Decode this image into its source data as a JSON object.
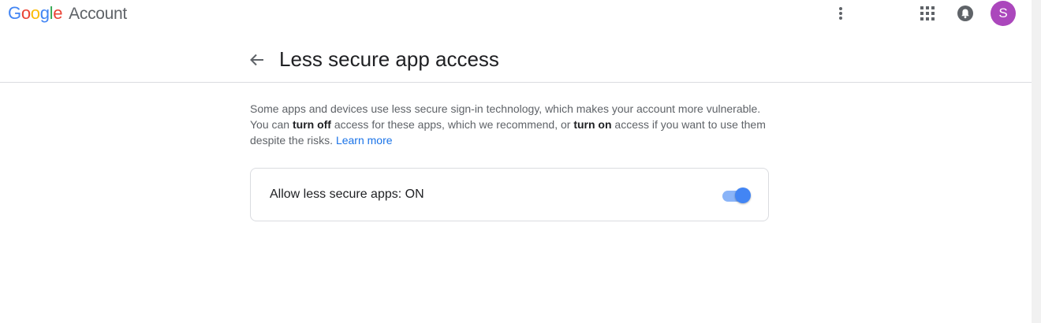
{
  "header": {
    "logo_letters": [
      {
        "char": "G",
        "color": "#4285F4"
      },
      {
        "char": "o",
        "color": "#EA4335"
      },
      {
        "char": "o",
        "color": "#FBBC05"
      },
      {
        "char": "g",
        "color": "#4285F4"
      },
      {
        "char": "l",
        "color": "#34A853"
      },
      {
        "char": "e",
        "color": "#EA4335"
      }
    ],
    "product_label": "Account",
    "icons": {
      "more": "more-vert-icon",
      "apps": "apps-grid-icon",
      "notifications": "bell-icon"
    },
    "avatar_initial": "S",
    "avatar_color": "#AB47BC"
  },
  "page": {
    "title": "Less secure app access",
    "back_icon": "arrow-back-icon"
  },
  "description": {
    "part1": "Some apps and devices use less secure sign-in technology, which makes your account more vulnerable. You can ",
    "bold1": "turn off",
    "part2": " access for these apps, which we recommend, or ",
    "bold2": "turn on",
    "part3": " access if you want to use them despite the risks. ",
    "link": "Learn more",
    "link_color": "#1A73E8"
  },
  "setting": {
    "label": "Allow less secure apps: ON",
    "toggle_on": true,
    "toggle_color": "#4285F4"
  }
}
